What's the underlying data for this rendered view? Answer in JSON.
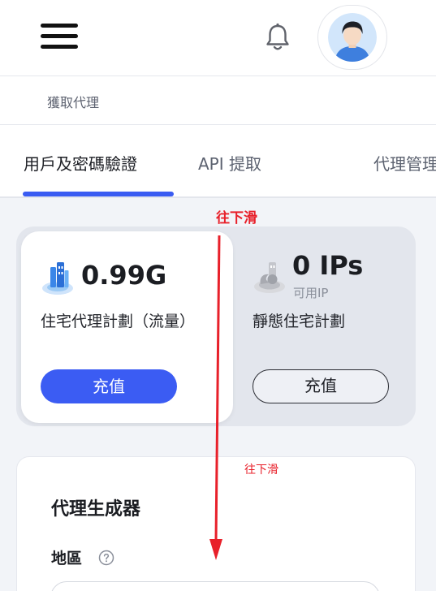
{
  "header": {
    "menu_icon": "hamburger-menu-icon",
    "notification_icon": "bell-icon",
    "avatar_icon": "user-avatar-icon"
  },
  "breadcrumb": {
    "label": "獲取代理"
  },
  "tabs": [
    {
      "label": "用戶及密碼驗證",
      "active": true
    },
    {
      "label": "API 提取",
      "active": false
    },
    {
      "label": "代理管理",
      "active": false
    }
  ],
  "plans": [
    {
      "amount": "0.99G",
      "title": "住宅代理計劃（流量）",
      "button": "充值",
      "icon": "residential-proxy-icon"
    },
    {
      "amount": "0 IPs",
      "sub": "可用IP",
      "title": "靜態住宅計劃",
      "button": "充值",
      "icon": "static-residential-icon"
    }
  ],
  "generator": {
    "title": "代理生成器",
    "region_label": "地區"
  },
  "annotations": {
    "scroll_hint_top": "往下滑",
    "scroll_hint_bottom": "往下滑"
  },
  "colors": {
    "accent": "#3b5cf3",
    "annotation": "#e8202a"
  }
}
